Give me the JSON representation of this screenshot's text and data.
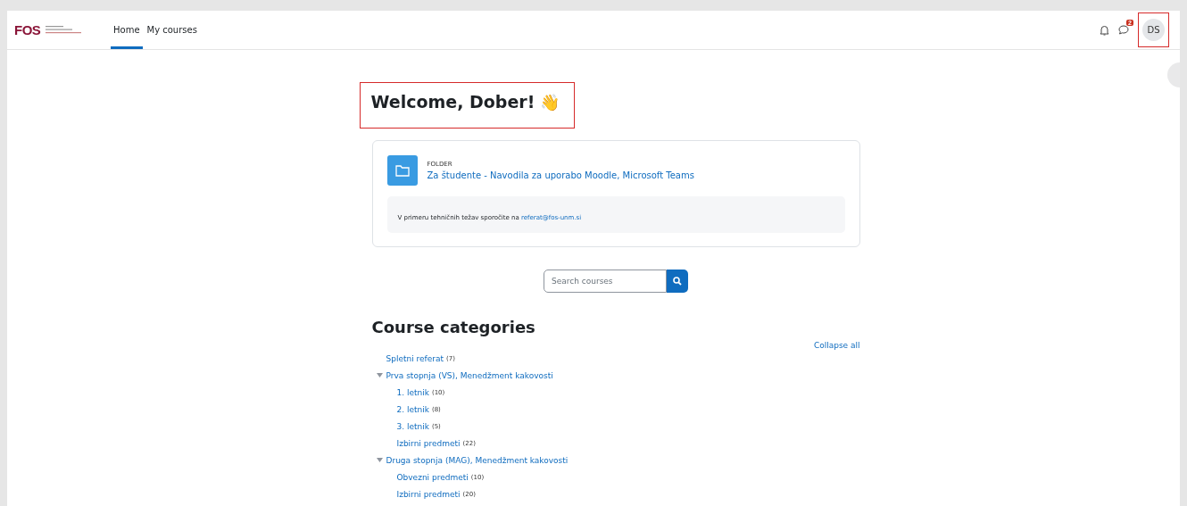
{
  "logo": {
    "mark": "FOS"
  },
  "nav": [
    {
      "label": "Home",
      "selected": true
    },
    {
      "label": "My courses",
      "selected": false
    }
  ],
  "notifications": {
    "messages_badge": "2"
  },
  "user": {
    "initials": "DS"
  },
  "welcome": {
    "title": "Welcome, Dober!",
    "emoji": "👋"
  },
  "folder": {
    "type": "FOLDER",
    "link": "Za študente - Navodila za uporabo Moodle, Microsoft Teams",
    "note": "V primeru tehničnih težav sporočite na",
    "email": "referat@fos-unm.si"
  },
  "search": {
    "placeholder": "Search courses"
  },
  "categories": {
    "title": "Course categories",
    "collapse": "Collapse all",
    "items": [
      {
        "name": "Spletni referat",
        "count": "(7)"
      },
      {
        "name": "Prva stopnja (VS), Menedžment kakovosti",
        "expanded": true,
        "children": [
          {
            "name": "1. letnik",
            "count": "(10)"
          },
          {
            "name": "2. letnik",
            "count": "(8)"
          },
          {
            "name": "3. letnik",
            "count": "(5)"
          },
          {
            "name": "Izbirni predmeti",
            "count": "(22)"
          }
        ]
      },
      {
        "name": "Druga stopnja (MAG), Menedžment kakovosti",
        "expanded": true,
        "children": [
          {
            "name": "Obvezni predmeti",
            "count": "(10)"
          },
          {
            "name": "Izbirni predmeti",
            "count": "(20)"
          }
        ]
      }
    ]
  }
}
